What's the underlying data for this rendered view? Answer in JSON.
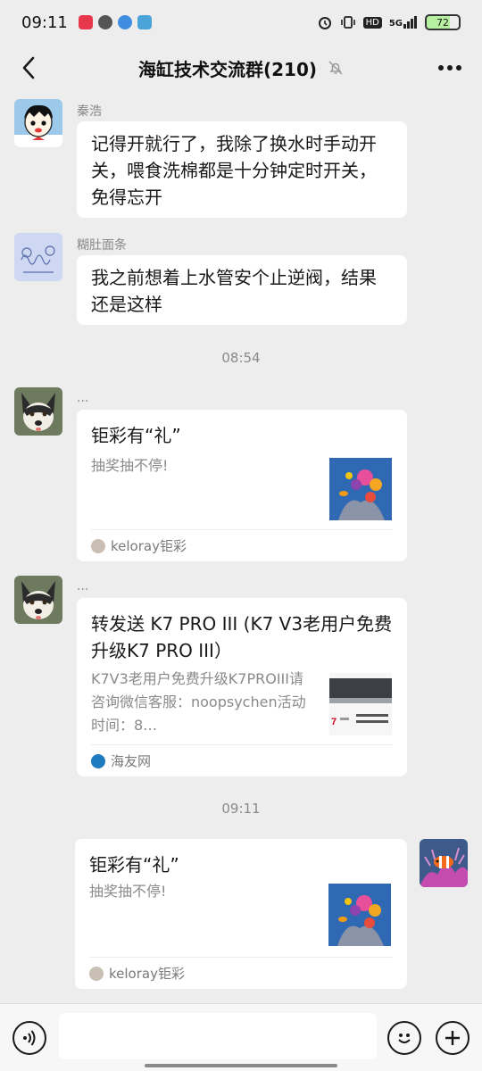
{
  "status_bar": {
    "time": "09:11",
    "signal_label": "5G",
    "hd_label": "HD",
    "battery": "72"
  },
  "header": {
    "title": "海缸技术交流群(210)",
    "back_icon": "chevron-left-icon",
    "mute_icon": "bell-off-icon",
    "more_icon": "more-dots-icon"
  },
  "messages": [
    {
      "sender": "秦浩",
      "text": "记得开就行了，我除了换水时手动开关，喂食洗棉都是十分钟定时开关，免得忘开"
    },
    {
      "sender": "糊肚面条",
      "text": "我之前想着上水管安个止逆阀，结果还是这样"
    }
  ],
  "timestamps": [
    "08:54",
    "09:11"
  ],
  "cards": [
    {
      "sender": "...",
      "title": "钜彩有“礼”",
      "desc": "抽奖抽不停!",
      "source": "keloray钜彩"
    },
    {
      "sender": "...",
      "title": "转发送 K7 PRO III (K7 V3老用户免费升级K7 PRO III）",
      "desc": "K7V3老用户免费升级K7PROIII请咨询微信客服：noopsychen活动时间：8…",
      "source": "海友网"
    },
    {
      "title": "钜彩有“礼”",
      "desc": "抽奖抽不停!",
      "source": "keloray钜彩"
    }
  ],
  "input_bar": {
    "voice_icon": "voice-icon",
    "emoji_icon": "emoji-icon",
    "plus_icon": "plus-icon",
    "placeholder": ""
  },
  "colors": {
    "background": "#ededed",
    "bubble": "#ffffff",
    "secondary_text": "#8a8a8a"
  }
}
